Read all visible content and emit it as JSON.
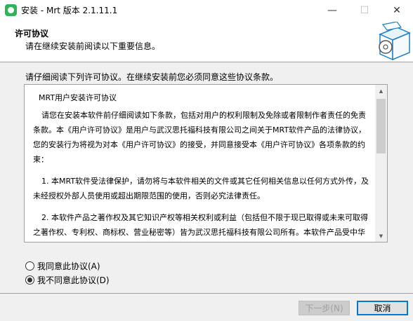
{
  "window": {
    "title": "安装 - Mrt 版本 2.1.11.1",
    "minimize_glyph": "—",
    "maximize_glyph": "☐",
    "close_glyph": "✕"
  },
  "header": {
    "title": "许可协议",
    "subtitle": "请在继续安装前阅读以下重要信息。",
    "graphic_icon": "installer-box-disc-icon"
  },
  "instruction": "请仔细阅读下列许可协议。在继续安装前您必须同意这些协议条款。",
  "license": {
    "title": "MRT用户安装许可协议",
    "paragraphs": [
      "请您在安装本软件前仔细阅读如下条款，包括对用户的权利限制及免除或者限制作者责任的免责条款。本《用户许可协议》是用户与武汉思托福科技有限公司之间关于MRT软件产品的法律协议，您的安装行为将视为对本《用户许可协议》的接受，并同意接受本《用户许可协议》各项条款的约束：",
      "1. 本MRT软件受法律保护，请勿将与本软件相关的文件或其它任何相关信息以任何方式外传，及未经授权外部人员使用或超出期限范围的使用，否则必究法律责任。",
      "2. 本软件产品之著作权及其它知识产权等相关权利或利益（包括但不限于现已取得或未来可取得之著作权、专利权、商标权、营业秘密等）皆为武汉思托福科技有限公司所有。本软件产品受中华人民共和国版权法及国际版权条约和其它知识产权法及条约的保护。"
    ]
  },
  "options": {
    "accept_label": "我同意此协议(A)",
    "decline_label": "我不同意此协议(D)",
    "selected": "decline"
  },
  "buttons": {
    "next_label": "下一步(N)",
    "cancel_label": "取消"
  }
}
